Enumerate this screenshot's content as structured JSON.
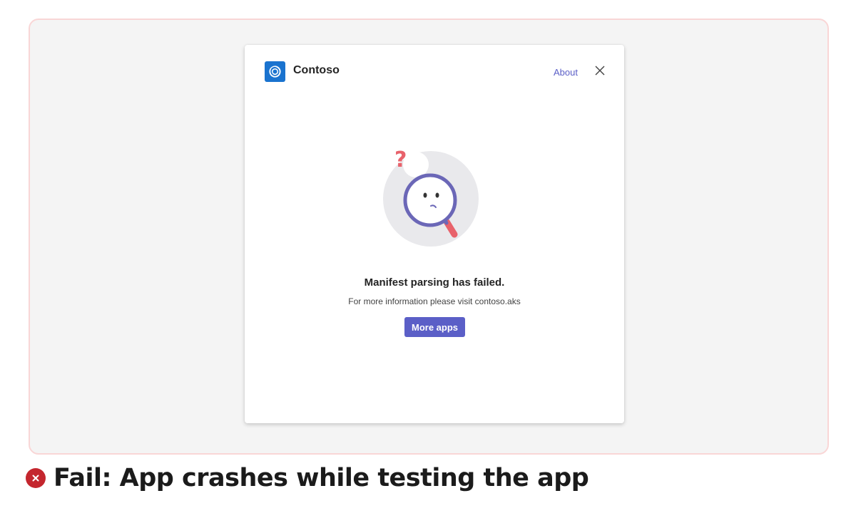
{
  "dialog": {
    "app_name": "Contoso",
    "about_label": "About",
    "close_icon": "close-icon",
    "app_logo_icon": "contoso-logo-icon",
    "illustration": "magnifier-question-illustration",
    "error_title": "Manifest parsing has failed.",
    "error_subtitle": "For more information please visit contoso.aks",
    "more_apps_label": "More apps"
  },
  "caption": {
    "status_icon": "fail-icon",
    "text": "Fail: App crashes while testing the app"
  },
  "colors": {
    "accent": "#5b5fc7",
    "logo_blue": "#1a73cf",
    "fail_red": "#c4262e",
    "frame_border": "#f9d6d6",
    "frame_bg": "#f4f4f4"
  }
}
